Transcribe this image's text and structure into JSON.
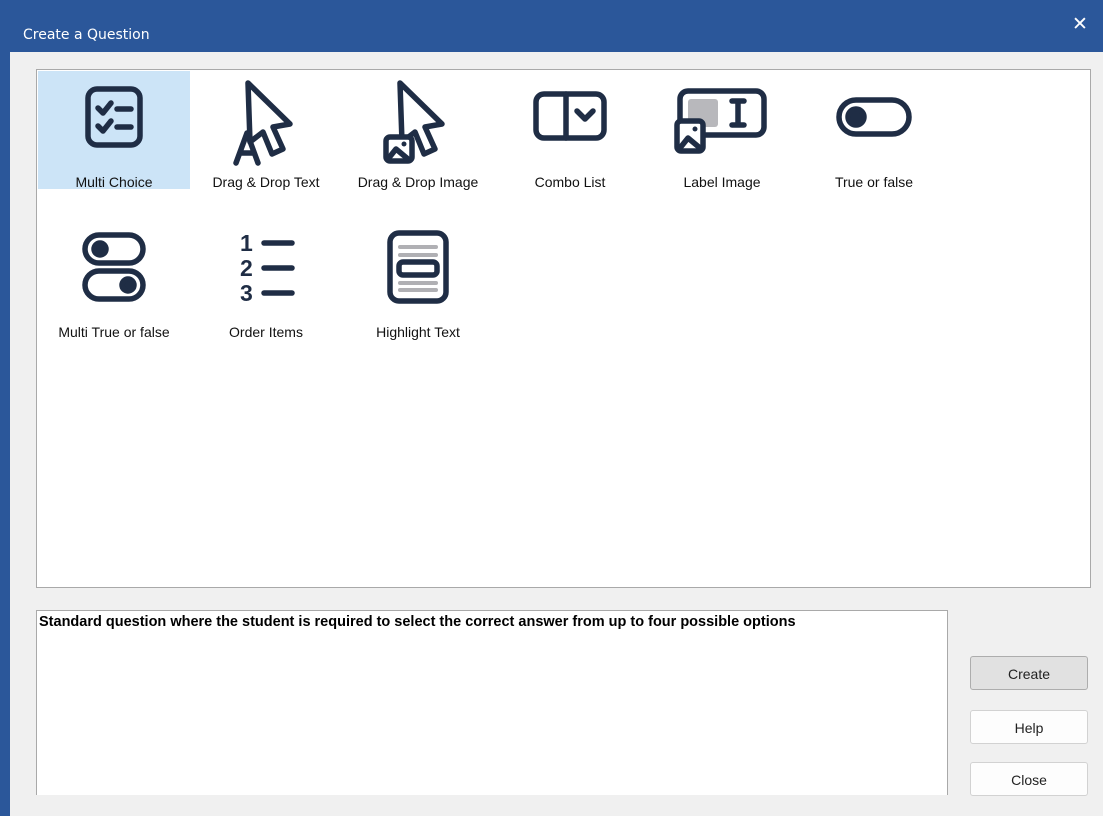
{
  "window": {
    "title": "Create a Question",
    "close_glyph": "✕"
  },
  "question_types": [
    {
      "label": "Multi Choice",
      "icon": "checklist-icon",
      "selected": true
    },
    {
      "label": "Drag & Drop Text",
      "icon": "cursor-text-icon",
      "selected": false
    },
    {
      "label": "Drag & Drop Image",
      "icon": "cursor-image-icon",
      "selected": false
    },
    {
      "label": "Combo List",
      "icon": "dropdown-icon",
      "selected": false
    },
    {
      "label": "Label Image",
      "icon": "label-image-icon",
      "selected": false
    },
    {
      "label": "True or false",
      "icon": "toggle-icon",
      "selected": false
    },
    {
      "label": "Multi True or false",
      "icon": "double-toggle-icon",
      "selected": false
    },
    {
      "label": "Order Items",
      "icon": "numbered-list-icon",
      "selected": false
    },
    {
      "label": "Highlight Text",
      "icon": "highlight-text-icon",
      "selected": false
    }
  ],
  "description": "Standard question where the student is required to select the correct answer from up to four possible options",
  "buttons": {
    "create": "Create",
    "help": "Help",
    "close": "Close"
  },
  "colors": {
    "title_bar": "#2b579a",
    "selection": "#cce4f7",
    "icon_stroke": "#1f2d45"
  }
}
